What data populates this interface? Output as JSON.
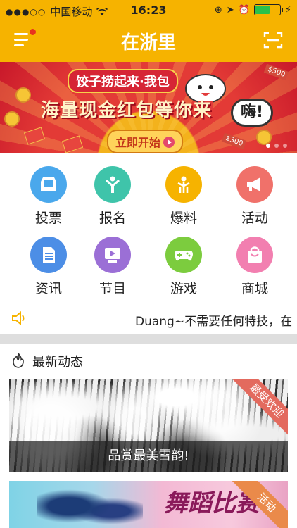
{
  "status_bar": {
    "carrier": "中国移动",
    "time": "16:23",
    "battery_level": 0.6
  },
  "nav": {
    "title": "在浙里"
  },
  "banner": {
    "subtitle": "饺子捞起来·我包",
    "headline": "海量现金红包等你来",
    "exclaim": "嗨!",
    "button_label": "立即开始",
    "money_tags": [
      "$500",
      "$300"
    ]
  },
  "grid": {
    "items": [
      {
        "label": "投票",
        "icon": "vote-icon",
        "color": "#4aa8ec"
      },
      {
        "label": "报名",
        "icon": "signup-icon",
        "color": "#3fc4aa"
      },
      {
        "label": "爆料",
        "icon": "tip-off-icon",
        "color": "#f6b300"
      },
      {
        "label": "活动",
        "icon": "megaphone-icon",
        "color": "#f0716a"
      },
      {
        "label": "资讯",
        "icon": "news-icon",
        "color": "#4c8ee6"
      },
      {
        "label": "节目",
        "icon": "tv-icon",
        "color": "#9b6fd6"
      },
      {
        "label": "游戏",
        "icon": "gamepad-icon",
        "color": "#7ccc3e"
      },
      {
        "label": "商城",
        "icon": "shopping-bag-icon",
        "color": "#f27fb0"
      }
    ]
  },
  "notice": {
    "text": "Duang~不需要任何特技，在"
  },
  "section": {
    "title": "最新动态"
  },
  "cards": [
    {
      "caption": "品赏最美雪韵!",
      "badge": "最受欢迎"
    },
    {
      "script": "舞蹈比赛",
      "badge": "活动"
    }
  ],
  "colors": {
    "brand": "#f6b300",
    "badge": "#e36a5e"
  }
}
